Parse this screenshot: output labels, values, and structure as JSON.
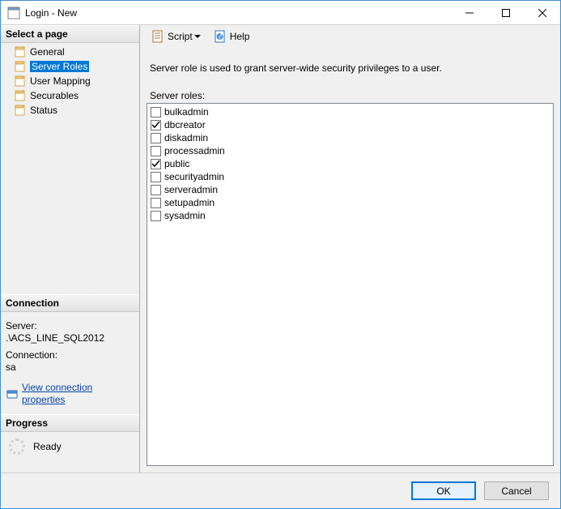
{
  "window": {
    "title": "Login - New"
  },
  "left": {
    "select_page": "Select a page",
    "pages": [
      {
        "label": "General"
      },
      {
        "label": "Server Roles"
      },
      {
        "label": "User Mapping"
      },
      {
        "label": "Securables"
      },
      {
        "label": "Status"
      }
    ],
    "selected_index": 1,
    "connection": {
      "header": "Connection",
      "server_label": "Server:",
      "server_value": ".\\ACS_LINE_SQL2012",
      "connection_label": "Connection:",
      "connection_value": "sa",
      "link": "View connection properties"
    },
    "progress": {
      "header": "Progress",
      "status": "Ready"
    }
  },
  "toolbar": {
    "script": "Script",
    "help": "Help"
  },
  "main": {
    "description": "Server role is used to grant server-wide security privileges to a user.",
    "roles_label": "Server roles:",
    "roles": [
      {
        "name": "bulkadmin",
        "checked": false
      },
      {
        "name": "dbcreator",
        "checked": true
      },
      {
        "name": "diskadmin",
        "checked": false
      },
      {
        "name": "processadmin",
        "checked": false
      },
      {
        "name": "public",
        "checked": true
      },
      {
        "name": "securityadmin",
        "checked": false
      },
      {
        "name": "serveradmin",
        "checked": false
      },
      {
        "name": "setupadmin",
        "checked": false
      },
      {
        "name": "sysadmin",
        "checked": false
      }
    ]
  },
  "footer": {
    "ok": "OK",
    "cancel": "Cancel"
  }
}
